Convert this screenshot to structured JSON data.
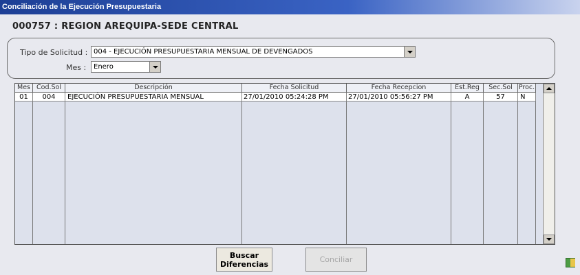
{
  "window": {
    "title": "Conciliación de la Ejecución Presupuestaria"
  },
  "entity": {
    "label": "000757 : REGION AREQUIPA-SEDE CENTRAL"
  },
  "filters": {
    "tipo_label": "Tipo de Solicitud :",
    "tipo_value": "004 - EJECUCIÓN PRESUPUESTARIA MENSUAL DE DEVENGADOS",
    "mes_label": "Mes :",
    "mes_value": "Enero"
  },
  "grid": {
    "headers": [
      "Mes",
      "Cod.Sol",
      "Descripción",
      "Fecha Solicitud",
      "Fecha Recepcion",
      "Est.Reg",
      "Sec.Sol",
      "Proc."
    ],
    "rows": [
      [
        "01",
        "004",
        "EJECUCIÓN PRESUPUESTARIA MENSUAL",
        "27/01/2010 05:24:28 PM",
        "27/01/2010 05:56:27 PM",
        "A",
        "57",
        "N"
      ]
    ]
  },
  "buttons": {
    "buscar_line1": "Buscar",
    "buscar_line2": "Diferencias",
    "conciliar": "Conciliar"
  },
  "icons": {
    "combo_dropdown": "chevron-down-icon",
    "scroll_up": "scroll-up-icon",
    "scroll_down": "scroll-down-icon",
    "export": "excel-export-icon"
  }
}
